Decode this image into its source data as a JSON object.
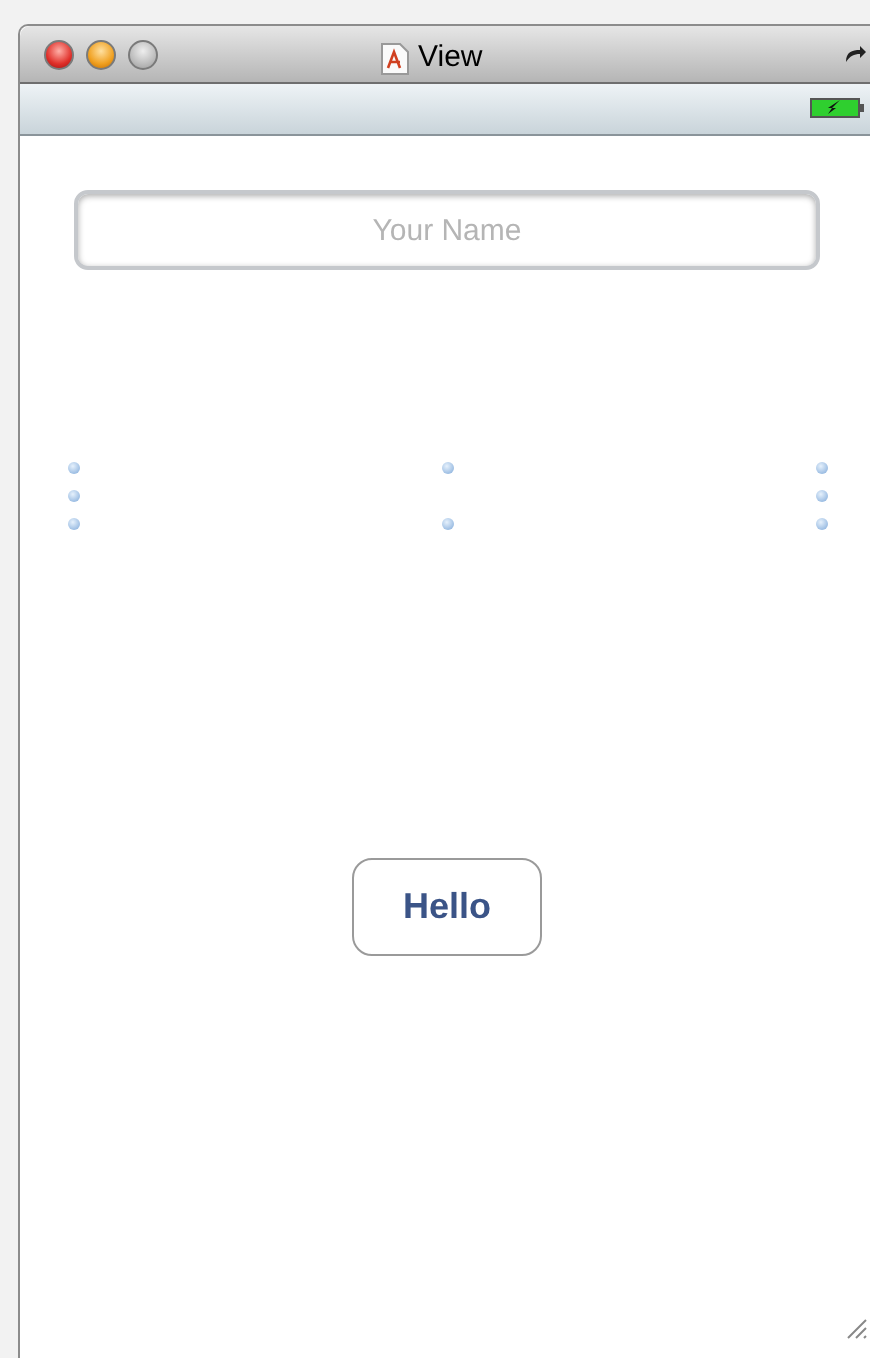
{
  "window": {
    "title": "View"
  },
  "status_bar": {
    "battery_charging": true
  },
  "name_field": {
    "placeholder": "Your Name"
  },
  "button": {
    "label": "Hello"
  }
}
